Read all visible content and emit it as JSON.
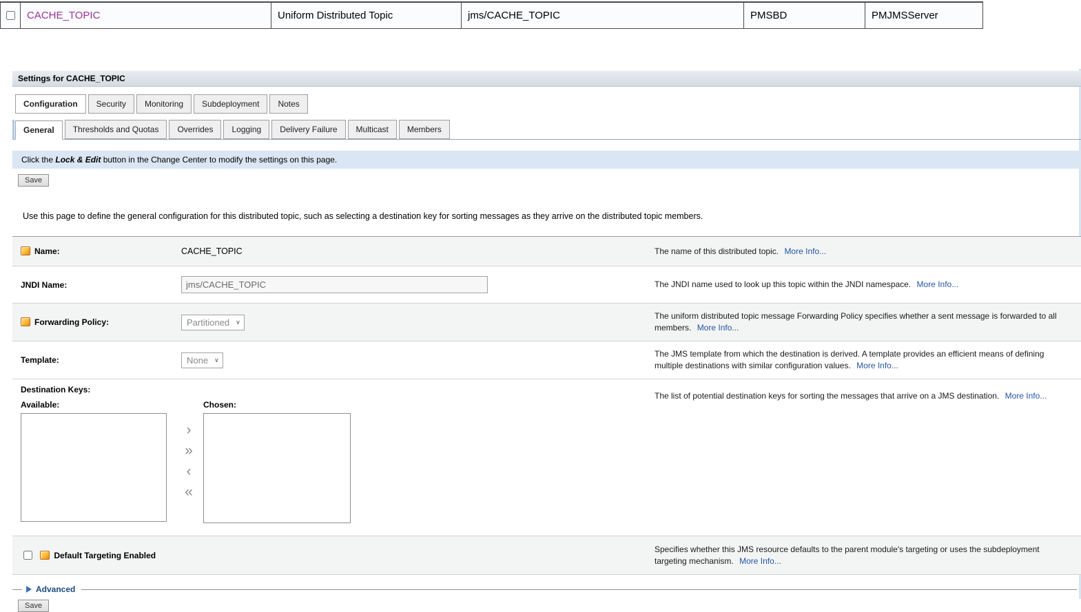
{
  "colors": {
    "link_purple": "#993399",
    "more_info_blue": "#2456a4",
    "notice_bar_bg": "#dbe6f4",
    "title_bar_bg": "#d9dfe6",
    "attr_icon_orange": "#ef8a1a"
  },
  "icons": {
    "select_chevron": "∨"
  },
  "top_table": {
    "columns": {
      "name": "CACHE_TOPIC",
      "type": "Uniform Distributed Topic",
      "jndi_name": "jms/CACHE_TOPIC",
      "subdeployment": "PMSBD",
      "server": "PMJMSServer"
    }
  },
  "settings": {
    "title": "Settings for CACHE_TOPIC",
    "tabs": [
      {
        "label": "Configuration"
      },
      {
        "label": "Security"
      },
      {
        "label": "Monitoring"
      },
      {
        "label": "Subdeployment"
      },
      {
        "label": "Notes"
      }
    ],
    "subtabs": [
      {
        "label": "General"
      },
      {
        "label": "Thresholds and Quotas"
      },
      {
        "label": "Overrides"
      },
      {
        "label": "Logging"
      },
      {
        "label": "Delivery Failure"
      },
      {
        "label": "Multicast"
      },
      {
        "label": "Members"
      }
    ],
    "notice": {
      "prefix": "Click the ",
      "emphasis": "Lock & Edit",
      "suffix": " button in the Change Center to modify the settings on this page."
    },
    "save_button": "Save",
    "save_button_bottom": "Save",
    "intro": "Use this page to define the general configuration for this distributed topic, such as selecting a destination key for sorting messages as they arrive on the distributed topic members.",
    "more_info": "More Info...",
    "fields": {
      "name": {
        "label": "Name:",
        "value": "CACHE_TOPIC",
        "help": "The name of this distributed topic."
      },
      "jndi": {
        "label": "JNDI Name:",
        "value": "jms/CACHE_TOPIC",
        "help": "The JNDI name used to look up this topic within the JNDI namespace."
      },
      "forwarding_policy": {
        "label": "Forwarding Policy:",
        "value": "Partitioned",
        "help": "The uniform distributed topic message Forwarding Policy specifies whether a sent message is forwarded to all members."
      },
      "template": {
        "label": "Template:",
        "value": "None",
        "help": "The JMS template from which the destination is derived. A template provides an efficient means of defining multiple destinations with similar configuration values."
      },
      "destination_keys": {
        "label": "Destination Keys:",
        "available_label": "Available:",
        "chosen_label": "Chosen:",
        "help": "The list of potential destination keys for sorting the messages that arrive on a JMS destination.",
        "transfer_buttons": [
          {
            "name": "move-selected-right",
            "glyph": "›"
          },
          {
            "name": "move-all-right",
            "glyph": "»"
          },
          {
            "name": "move-selected-left",
            "glyph": "‹"
          },
          {
            "name": "move-all-left",
            "glyph": "«"
          }
        ]
      },
      "default_targeting": {
        "label": "Default Targeting Enabled",
        "help": "Specifies whether this JMS resource defaults to the parent module's targeting or uses the subdeployment targeting mechanism."
      }
    },
    "advanced_label": "Advanced"
  }
}
